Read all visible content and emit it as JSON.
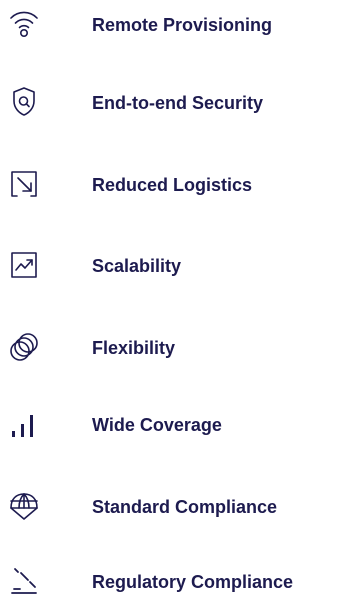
{
  "features": [
    {
      "icon": "wifi-signal-icon",
      "label": "Remote Provisioning"
    },
    {
      "icon": "security-shield-icon",
      "label": "End-to-end Security"
    },
    {
      "icon": "arrow-box-icon",
      "label": "Reduced Logistics"
    },
    {
      "icon": "trend-chart-icon",
      "label": "Scalability"
    },
    {
      "icon": "overlapping-circles-icon",
      "label": "Flexibility"
    },
    {
      "icon": "signal-bars-icon",
      "label": "Wide Coverage"
    },
    {
      "icon": "globe-umbrella-icon",
      "label": "Standard Compliance"
    },
    {
      "icon": "gavel-icon",
      "label": "Regulatory Compliance"
    }
  ],
  "colors": {
    "text": "#1d1b4f",
    "icon": "#1d1b4f",
    "background": "#ffffff"
  }
}
